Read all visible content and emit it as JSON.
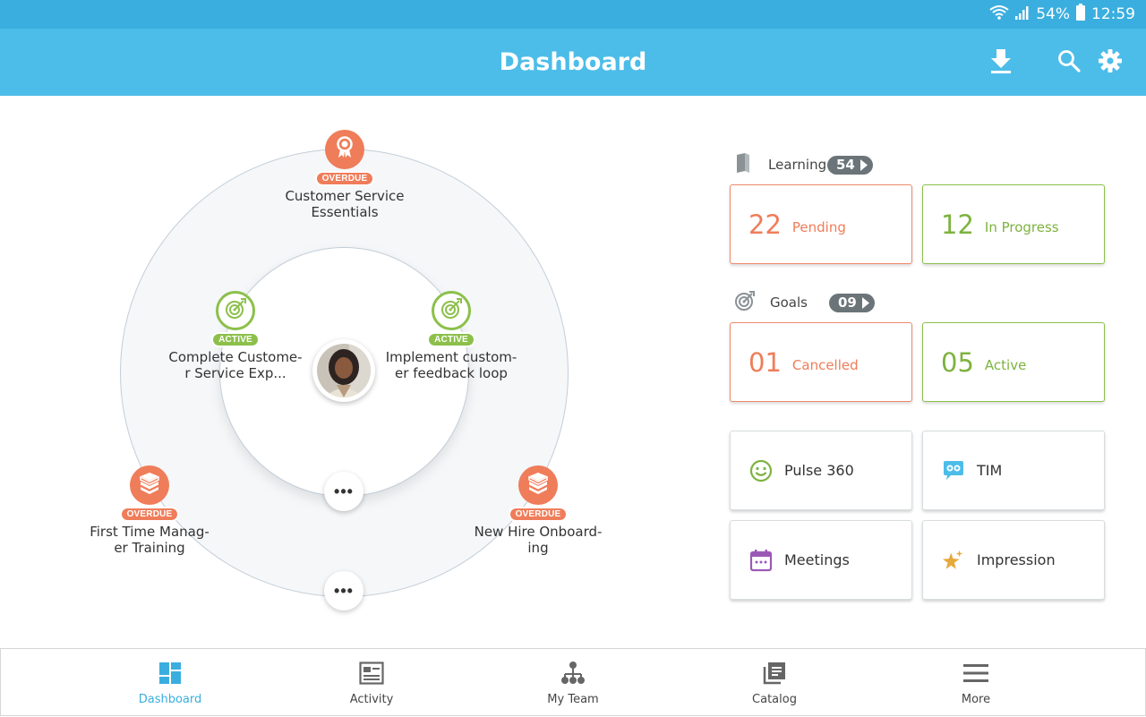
{
  "status_bar": {
    "battery": "54%",
    "time": "12:59",
    "icons": [
      "wifi-icon",
      "signal-icon",
      "battery-icon"
    ]
  },
  "app_bar": {
    "title": "Dashboard",
    "actions": [
      "download-icon",
      "search-icon",
      "settings-icon"
    ]
  },
  "orbit": {
    "nodes": [
      {
        "badge": "OVERDUE",
        "label_lines": [
          "Customer Service",
          "Essentials"
        ],
        "icon": "award-ribbon-icon",
        "color": "#ef7d5a"
      },
      {
        "badge": "ACTIVE",
        "label_lines": [
          "Complete Custome-",
          "r Service Exp..."
        ],
        "icon": "target-icon",
        "color": "#8cc04b"
      },
      {
        "badge": "ACTIVE",
        "label_lines": [
          "Implement custom-",
          "er feedback loop"
        ],
        "icon": "target-icon",
        "color": "#8cc04b"
      },
      {
        "badge": "OVERDUE",
        "label_lines": [
          "First Time Manag-",
          "er Training"
        ],
        "icon": "books-icon",
        "color": "#ef7d5a"
      },
      {
        "badge": "OVERDUE",
        "label_lines": [
          "New Hire Onboard-",
          "ing"
        ],
        "icon": "books-icon",
        "color": "#ef7d5a"
      }
    ],
    "more_label": "•••"
  },
  "learning": {
    "label": "Learning",
    "count": "54",
    "cards": [
      {
        "number": "22",
        "label": "Pending"
      },
      {
        "number": "12",
        "label": "In Progress"
      }
    ]
  },
  "goals": {
    "label": "Goals",
    "count": "09",
    "cards": [
      {
        "number": "01",
        "label": "Cancelled"
      },
      {
        "number": "05",
        "label": "Active"
      }
    ]
  },
  "tools": [
    {
      "label": "Pulse 360",
      "icon": "smiley-icon"
    },
    {
      "label": "TIM",
      "icon": "chat-glasses-icon"
    },
    {
      "label": "Meetings",
      "icon": "calendar-icon"
    },
    {
      "label": "Impression",
      "icon": "stars-icon"
    }
  ],
  "bottom_nav": [
    {
      "label": "Dashboard",
      "icon": "dashboard-icon",
      "active": true
    },
    {
      "label": "Activity",
      "icon": "activity-icon",
      "active": false
    },
    {
      "label": "My Team",
      "icon": "team-icon",
      "active": false
    },
    {
      "label": "Catalog",
      "icon": "catalog-icon",
      "active": false
    },
    {
      "label": "More",
      "icon": "menu-icon",
      "active": false
    }
  ],
  "colors": {
    "primary": "#4cbde9",
    "status_bar": "#3aaedf",
    "overdue": "#ef7d5a",
    "active": "#8cc04b"
  }
}
